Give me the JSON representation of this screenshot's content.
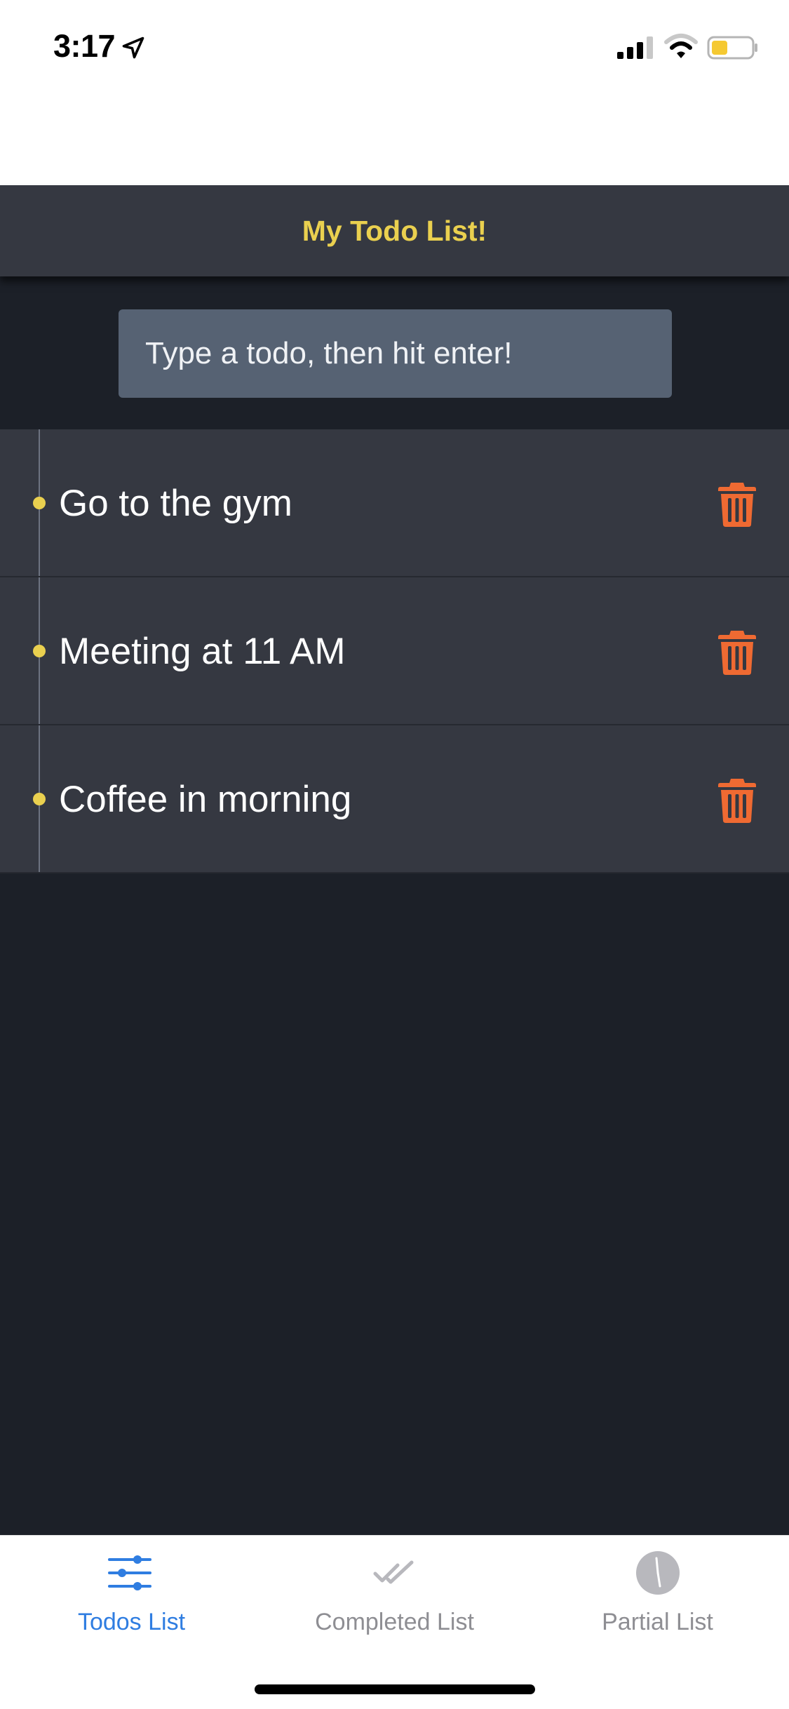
{
  "status_bar": {
    "time": "3:17",
    "icons": [
      "location-arrow-icon",
      "cellular-signal-icon",
      "wifi-icon",
      "battery-icon"
    ],
    "battery_color": "#f5c932"
  },
  "header": {
    "title": "My Todo List!"
  },
  "input": {
    "placeholder": "Type a todo, then hit enter!",
    "value": ""
  },
  "todos": [
    {
      "text": "Go to the gym",
      "icon": "trash-icon"
    },
    {
      "text": "Meeting at 11 AM",
      "icon": "trash-icon"
    },
    {
      "text": "Coffee in morning",
      "icon": "trash-icon"
    }
  ],
  "tabs": [
    {
      "label": "Todos List",
      "icon": "sliders-icon",
      "active": true
    },
    {
      "label": "Completed List",
      "icon": "double-check-icon",
      "active": false
    },
    {
      "label": "Partial List",
      "icon": "clock-icon",
      "active": false
    }
  ],
  "colors": {
    "background": "#1c2028",
    "header_bg": "#353841",
    "accent_yellow": "#ead04f",
    "delete_orange": "#ef6a32",
    "input_bg": "#566273",
    "tab_active": "#2f7de1",
    "tab_inactive": "#8e8e93"
  }
}
